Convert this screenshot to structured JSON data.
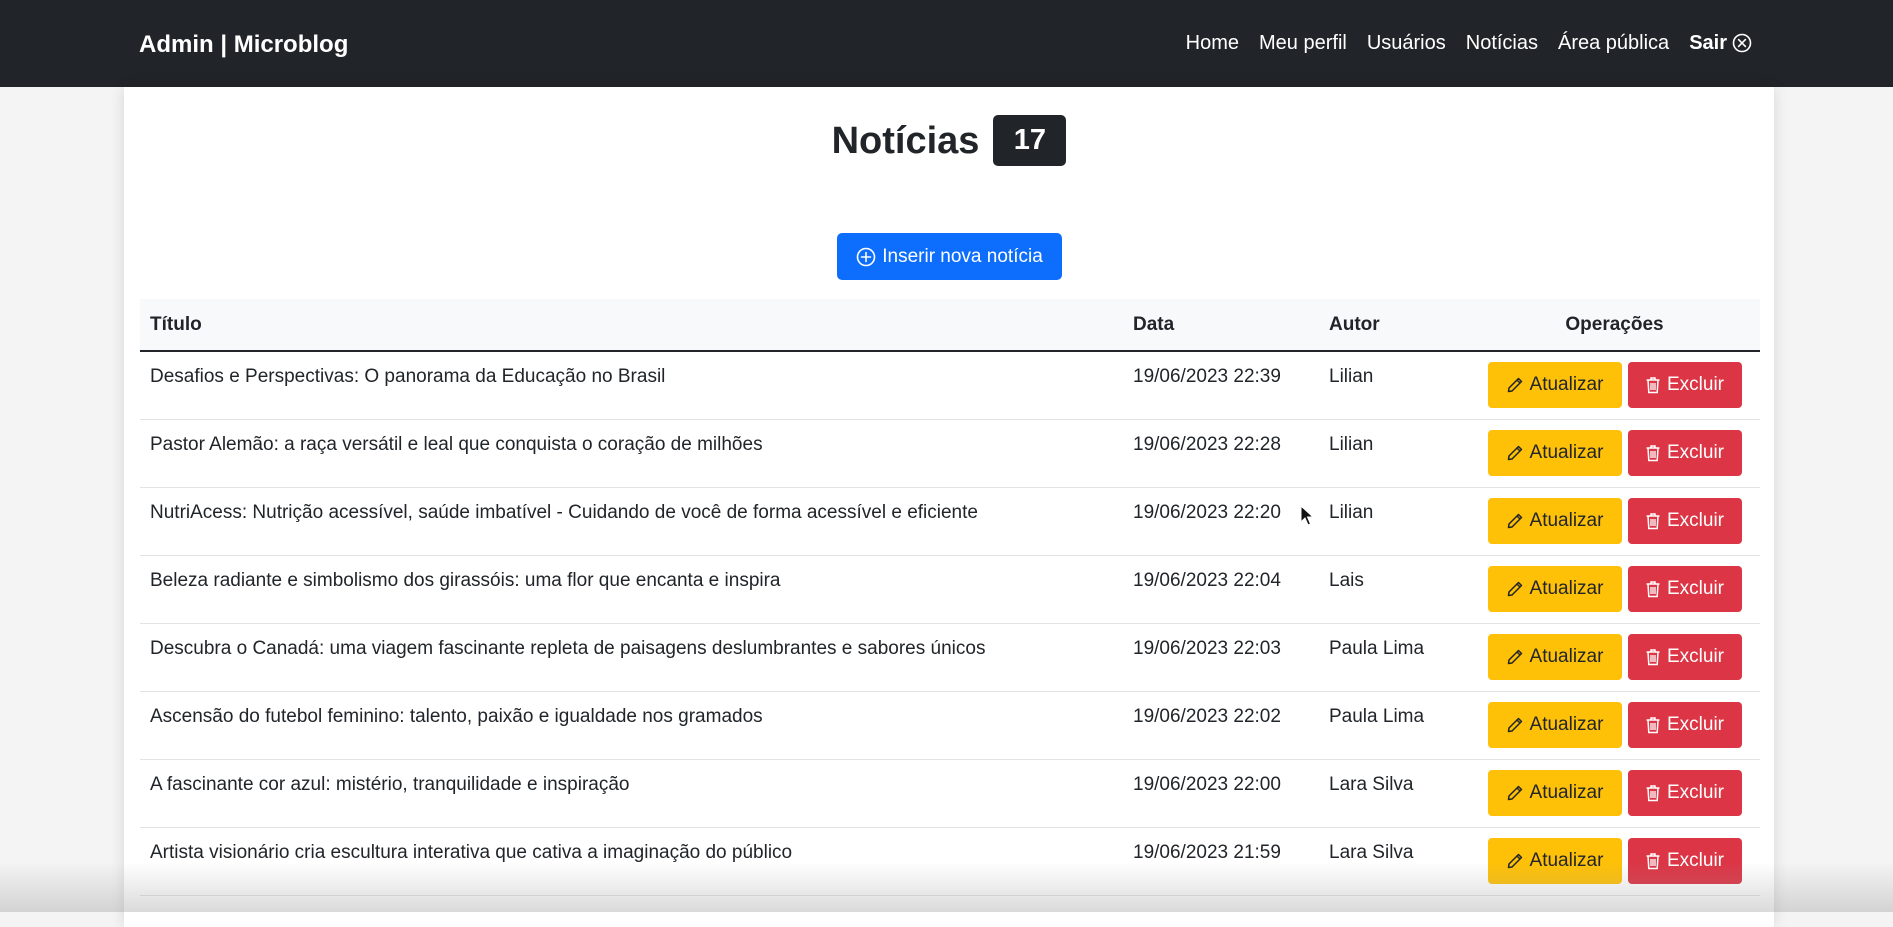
{
  "navbar": {
    "brand": "Admin | Microblog",
    "links": [
      {
        "label": "Home"
      },
      {
        "label": "Meu perfil"
      },
      {
        "label": "Usuários"
      },
      {
        "label": "Notícias"
      },
      {
        "label": "Área pública"
      }
    ],
    "logout": "Sair"
  },
  "page": {
    "title": "Notícias",
    "count": "17",
    "new_button": "Inserir nova notícia"
  },
  "table": {
    "headers": {
      "title": "Título",
      "date": "Data",
      "author": "Autor",
      "operations": "Operações"
    },
    "update_label": "Atualizar",
    "delete_label": "Excluir",
    "rows": [
      {
        "title": "Desafios e Perspectivas: O panorama da Educação no Brasil",
        "date": "19/06/2023 22:39",
        "author": "Lilian"
      },
      {
        "title": "Pastor Alemão: a raça versátil e leal que conquista o coração de milhões",
        "date": "19/06/2023 22:28",
        "author": "Lilian"
      },
      {
        "title": "NutriAcess: Nutrição acessível, saúde imbatível - Cuidando de você de forma acessível e eficiente",
        "date": "19/06/2023 22:20",
        "author": "Lilian"
      },
      {
        "title": "Beleza radiante e simbolismo dos girassóis: uma flor que encanta e inspira",
        "date": "19/06/2023 22:04",
        "author": "Lais"
      },
      {
        "title": "Descubra o Canadá: uma viagem fascinante repleta de paisagens deslumbrantes e sabores únicos",
        "date": "19/06/2023 22:03",
        "author": "Paula Lima"
      },
      {
        "title": "Ascensão do futebol feminino: talento, paixão e igualdade nos gramados",
        "date": "19/06/2023 22:02",
        "author": "Paula Lima"
      },
      {
        "title": "A fascinante cor azul: mistério, tranquilidade e inspiração",
        "date": "19/06/2023 22:00",
        "author": "Lara Silva"
      },
      {
        "title": "Artista visionário cria escultura interativa que cativa a imaginação do público",
        "date": "19/06/2023 21:59",
        "author": "Lara Silva"
      }
    ]
  },
  "colors": {
    "navbar": "#212529",
    "primary": "#0d6efd",
    "warning": "#ffc107",
    "danger": "#dc3545"
  },
  "icons": {
    "logout": "x-circle-icon",
    "new": "plus-circle-icon",
    "update": "pencil-icon",
    "delete": "trash-icon"
  }
}
